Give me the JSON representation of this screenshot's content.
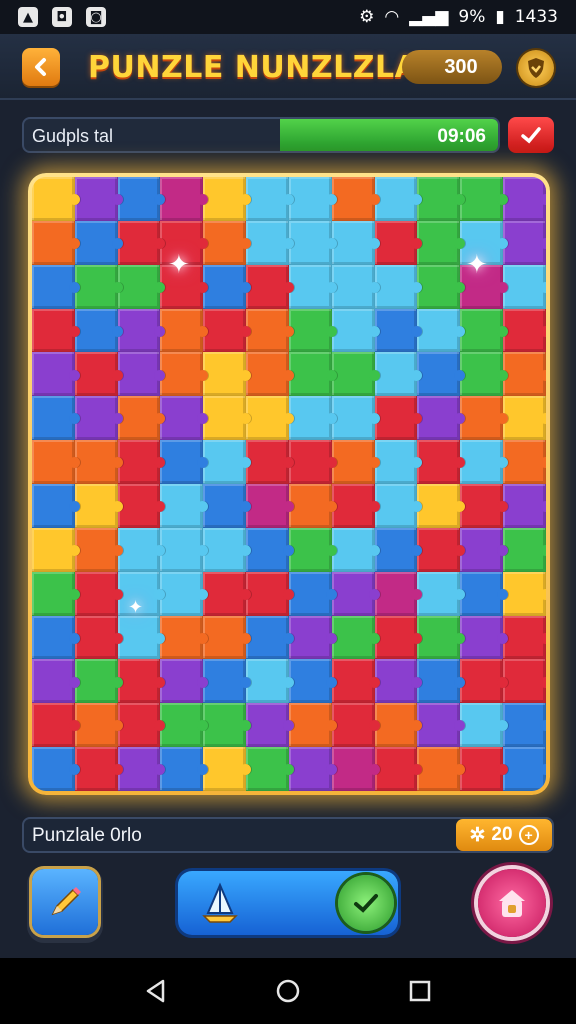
{
  "status_bar": {
    "left_icons": [
      "app-icon",
      "notification-icon",
      "message-icon"
    ],
    "battery": "9%",
    "time": "1433"
  },
  "header": {
    "title": "PUNZLE NUNZLZLAI",
    "coins": "300"
  },
  "progress": {
    "label": "Gudpls tal",
    "time": "09:06",
    "fill_fraction": 0.46
  },
  "info_bar": {
    "label": "Punzlale 0rlo",
    "hint_count": "20"
  },
  "colors": {
    "red": "#e02a3a",
    "orange": "#f36a22",
    "yellow": "#ffc72c",
    "green": "#3cc24a",
    "lightblue": "#58c8f0",
    "blue": "#2f7fe0",
    "purple": "#8a3fcf",
    "magenta": "#c22a86",
    "accent_gold": "#ffd53a"
  },
  "board": {
    "cols": 12,
    "rows": 14,
    "pieces": [
      "yellow",
      "purple",
      "blue",
      "magenta",
      "yellow",
      "lightblue",
      "lightblue",
      "orange",
      "lightblue",
      "green",
      "green",
      "purple",
      "orange",
      "blue",
      "red",
      "red",
      "orange",
      "lightblue",
      "lightblue",
      "lightblue",
      "red",
      "green",
      "lightblue",
      "purple",
      "blue",
      "green",
      "green",
      "red",
      "blue",
      "red",
      "lightblue",
      "lightblue",
      "lightblue",
      "green",
      "magenta",
      "lightblue",
      "red",
      "blue",
      "purple",
      "orange",
      "red",
      "orange",
      "green",
      "lightblue",
      "blue",
      "lightblue",
      "green",
      "red",
      "purple",
      "red",
      "purple",
      "orange",
      "yellow",
      "orange",
      "green",
      "green",
      "lightblue",
      "blue",
      "green",
      "orange",
      "blue",
      "purple",
      "orange",
      "purple",
      "yellow",
      "yellow",
      "lightblue",
      "lightblue",
      "red",
      "purple",
      "orange",
      "yellow",
      "orange",
      "orange",
      "red",
      "blue",
      "lightblue",
      "red",
      "red",
      "orange",
      "lightblue",
      "red",
      "lightblue",
      "orange",
      "blue",
      "yellow",
      "red",
      "lightblue",
      "blue",
      "magenta",
      "orange",
      "red",
      "lightblue",
      "yellow",
      "red",
      "purple",
      "yellow",
      "orange",
      "lightblue",
      "lightblue",
      "lightblue",
      "blue",
      "green",
      "lightblue",
      "blue",
      "red",
      "purple",
      "green",
      "green",
      "red",
      "lightblue",
      "lightblue",
      "red",
      "red",
      "blue",
      "purple",
      "magenta",
      "lightblue",
      "blue",
      "yellow",
      "blue",
      "red",
      "lightblue",
      "orange",
      "orange",
      "blue",
      "purple",
      "green",
      "red",
      "green",
      "purple",
      "red",
      "purple",
      "green",
      "red",
      "purple",
      "blue",
      "lightblue",
      "blue",
      "red",
      "purple",
      "blue",
      "red",
      "red",
      "red",
      "orange",
      "red",
      "green",
      "green",
      "purple",
      "orange",
      "red",
      "orange",
      "purple",
      "lightblue",
      "blue",
      "blue",
      "red",
      "purple",
      "blue",
      "yellow",
      "green",
      "purple",
      "magenta",
      "red",
      "orange",
      "red",
      "blue"
    ]
  }
}
